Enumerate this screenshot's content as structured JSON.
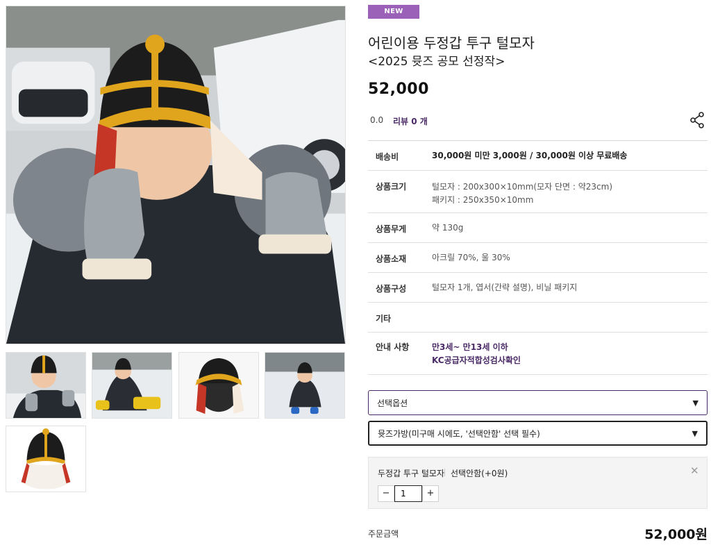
{
  "gallery": {
    "main_alt": "child wearing knit hat and mittens in snow",
    "thumbnails": [
      {
        "label": "thumb-1"
      },
      {
        "label": "thumb-2"
      },
      {
        "label": "thumb-3"
      },
      {
        "label": "thumb-4"
      },
      {
        "label": "thumb-5"
      }
    ]
  },
  "product": {
    "badge": "NEW",
    "title_line1": "어린이용 두정갑 투구 털모자",
    "title_line2": "<2025 뮷즈 공모 선정작>",
    "price": "52,000",
    "rating": "0.0",
    "review": "리뷰 0 개"
  },
  "specs": {
    "shipping": {
      "label": "배송비",
      "value": "30,000원 미만 3,000원 / 30,000원 이상 무료배송"
    },
    "size": {
      "label": "상품크기",
      "line1": "털모자 : 200x300×10mm(모자 단면 : 약23cm)",
      "line2": "패키지 : 250x350×10mm"
    },
    "weight": {
      "label": "상품무게",
      "value": "약 130g"
    },
    "material": {
      "label": "상품소재",
      "value": "아크릴 70%, 울 30%"
    },
    "composition": {
      "label": "상품구성",
      "value": "털모자 1개, 엽서(간략 설명), 비닐 패키지"
    },
    "etc": {
      "label": "기타",
      "value": ""
    },
    "notice": {
      "label": "안내 사항",
      "line1": "만3세~ 만13세 이하",
      "line2": "KC공급자적합성검사확인"
    }
  },
  "options": {
    "select1": "선택옵션",
    "select2": "뮷즈가방(미구매 시에도, '선택안함' 선택 필수)"
  },
  "selected_item": {
    "name": "두정갑 투구 털모자",
    "option": "선택안함(+0원)",
    "quantity": "1",
    "minus": "−",
    "plus": "+",
    "close": "✕"
  },
  "order": {
    "label": "주문금액",
    "total": "52,000원"
  },
  "colors": {
    "badge": "#9b61b8",
    "accent": "#4a2a66",
    "hat_black": "#1c1c1c",
    "hat_yellow": "#e0a51c"
  }
}
